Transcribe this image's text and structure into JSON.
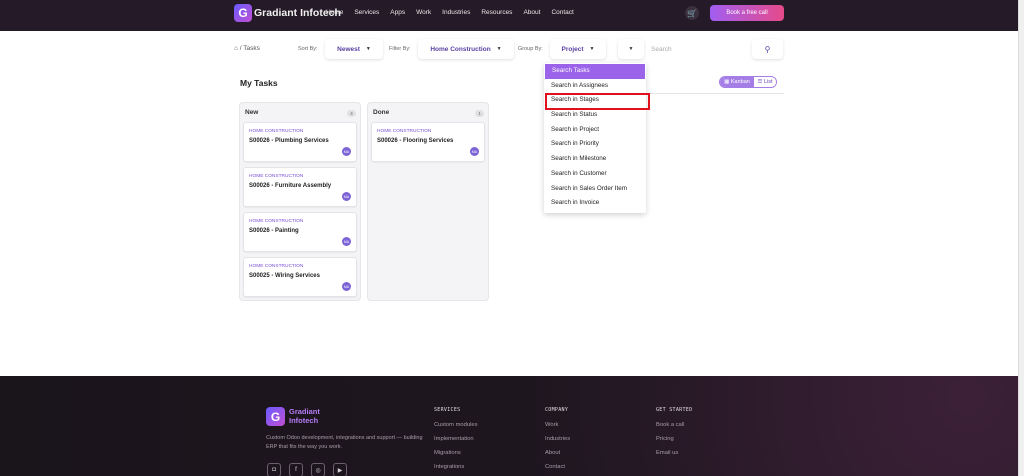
{
  "navbar": {
    "logo_text": "Gradiant Infotech",
    "links": [
      "Home",
      "Services",
      "Apps",
      "Work",
      "Industries",
      "Resources",
      "About",
      "Contact"
    ],
    "cart_icon": "cart-icon",
    "cta_label": "Book a free call"
  },
  "toolbar": {
    "breadcrumb_current": "Tasks",
    "sort_label": "Sort By:",
    "sort_value": "Newest",
    "filter_label": "Filter By:",
    "filter_value": "Home Construction",
    "group_label": "Group By:",
    "group_value": "Project",
    "search_placeholder": "Search"
  },
  "search_dropdown": {
    "items": [
      "Search Tasks",
      "Search in Assignees",
      "Search in Stages",
      "Search in Status",
      "Search in Project",
      "Search in Priority",
      "Search in Milestone",
      "Search in Customer",
      "Search in Sales Order Item",
      "Search in Invoice"
    ],
    "active_index": 0,
    "highlighted_index": 2
  },
  "main": {
    "title": "My Tasks",
    "view_kanban": "Kanban",
    "view_list": "List"
  },
  "kanban": {
    "columns": [
      {
        "title": "New",
        "count": "4",
        "cards": [
          {
            "project": "HOME CONSTRUCTION",
            "title": "S00026 - Plumbing Services",
            "avatar": "MA"
          },
          {
            "project": "HOME CONSTRUCTION",
            "title": "S00026 - Furniture Assembly",
            "avatar": "MA"
          },
          {
            "project": "HOME CONSTRUCTION",
            "title": "S00026 - Painting",
            "avatar": "MA"
          },
          {
            "project": "HOME CONSTRUCTION",
            "title": "S00025 - Wiring Services",
            "avatar": "MA"
          }
        ]
      },
      {
        "title": "Done",
        "count": "1",
        "cards": [
          {
            "project": "HOME CONSTRUCTION",
            "title": "S00026 - Flooring Services",
            "avatar": "MA"
          }
        ]
      }
    ]
  },
  "footer": {
    "logo_text": "Gradiant Infotech",
    "description": "Custom Odoo development, integrations and support — building ERP that fits the way you work.",
    "socials": [
      "instagram-icon",
      "facebook-icon",
      "linkedin-icon",
      "youtube-icon"
    ],
    "services": {
      "title": "SERVICES",
      "links": [
        "Custom modules",
        "Implementation",
        "Migrations",
        "Integrations"
      ]
    },
    "company": {
      "title": "COMPANY",
      "links": [
        "Work",
        "Industries",
        "About",
        "Contact"
      ]
    },
    "get_started": {
      "title": "GET STARTED",
      "links": [
        "Book a call",
        "Pricing",
        "Email us"
      ]
    }
  },
  "colors": {
    "nav_bg": "#251a27",
    "accent": "#9b62ea",
    "cta_gradient_start": "#a25ef2",
    "cta_gradient_end": "#e64a8a",
    "highlight_box": "#e0101c"
  }
}
